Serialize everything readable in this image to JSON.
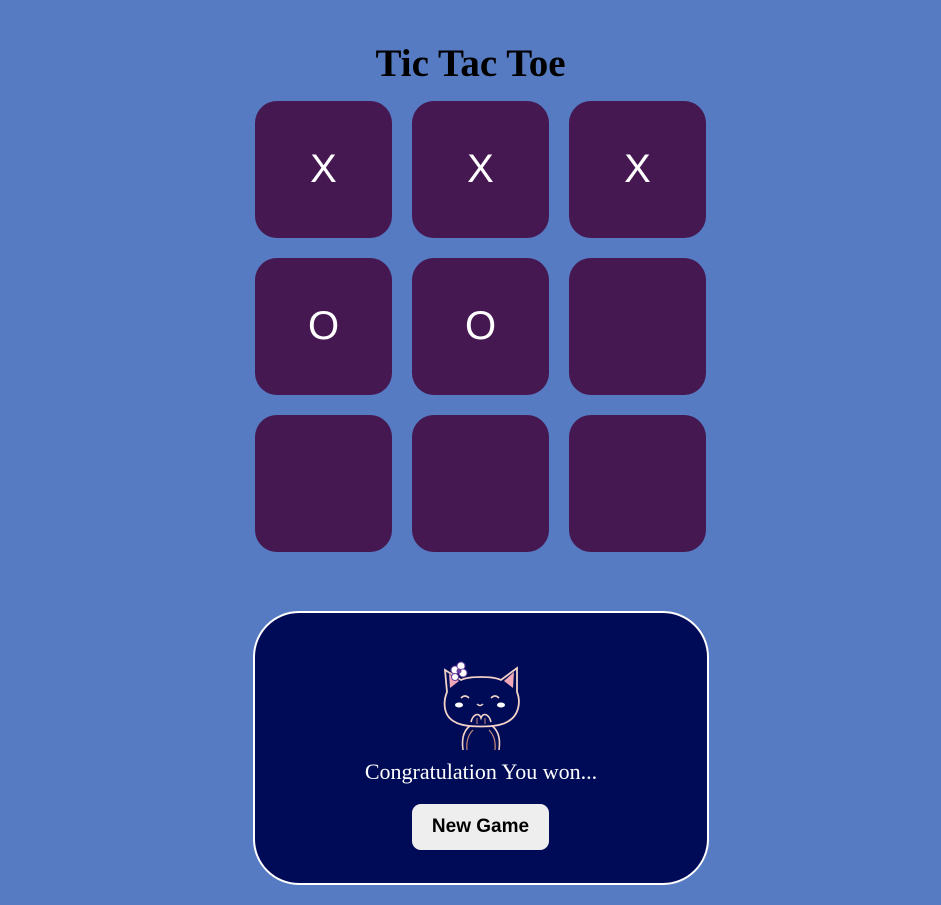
{
  "page": {
    "title": "Tic Tac Toe",
    "background_color": "#567bc2"
  },
  "board": {
    "cell_color": "#461852",
    "mark_color": "#ffffff",
    "cells": [
      "X",
      "X",
      "X",
      "O",
      "O",
      "",
      "",
      "",
      ""
    ]
  },
  "winner_message": {
    "text": "Congratulation You won...",
    "box_color": "#000b57",
    "image": "cat-celebration-icon",
    "button_label": "New Game"
  }
}
